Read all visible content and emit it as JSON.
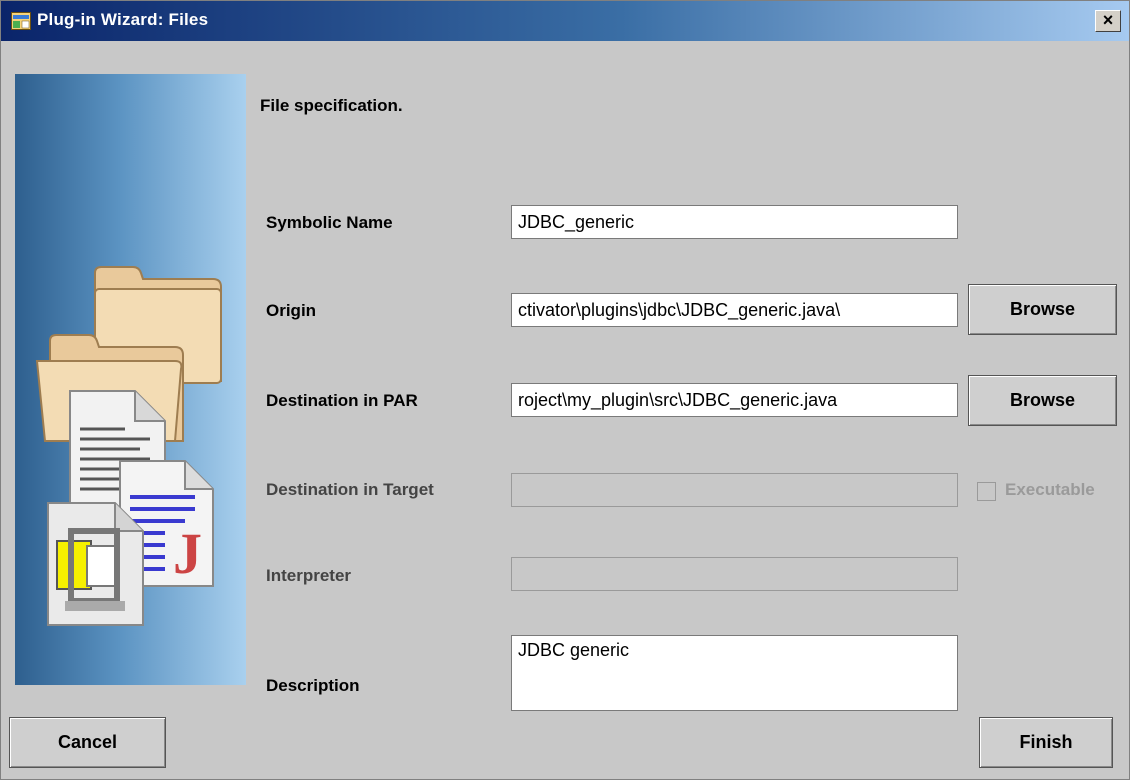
{
  "window": {
    "title": "Plug-in Wizard: Files",
    "close_label": "×",
    "icon": "wizard-window-icon"
  },
  "header": {
    "text": "File specification."
  },
  "form": {
    "symbolic_name": {
      "label": "Symbolic Name",
      "value": "JDBC_generic"
    },
    "origin": {
      "label": "Origin",
      "value": "\\ctivator\\plugins\\jdbc\\JDBC_generic.java",
      "browse_label": "Browse"
    },
    "destination_par": {
      "label": "Destination in PAR",
      "value": "roject\\my_plugin\\src\\JDBC_generic.java",
      "browse_label": "Browse"
    },
    "destination_target": {
      "label": "Destination in Target",
      "value": "",
      "checkbox_label": "Executable",
      "checked": false
    },
    "interpreter": {
      "label": "Interpreter",
      "value": ""
    },
    "description": {
      "label": "Description",
      "value": "JDBC generic"
    }
  },
  "buttons": {
    "cancel": "Cancel",
    "finish": "Finish"
  },
  "colors": {
    "dialog_bg": "#c8c8c8",
    "titlebar_start": "#0a246a",
    "titlebar_end": "#a6caf0",
    "side_panel_dark": "#2e5f8e",
    "side_panel_light": "#a9d0ee"
  },
  "icons": [
    "folder-icon",
    "text-document-icon",
    "java-file-icon",
    "archive-icon"
  ]
}
